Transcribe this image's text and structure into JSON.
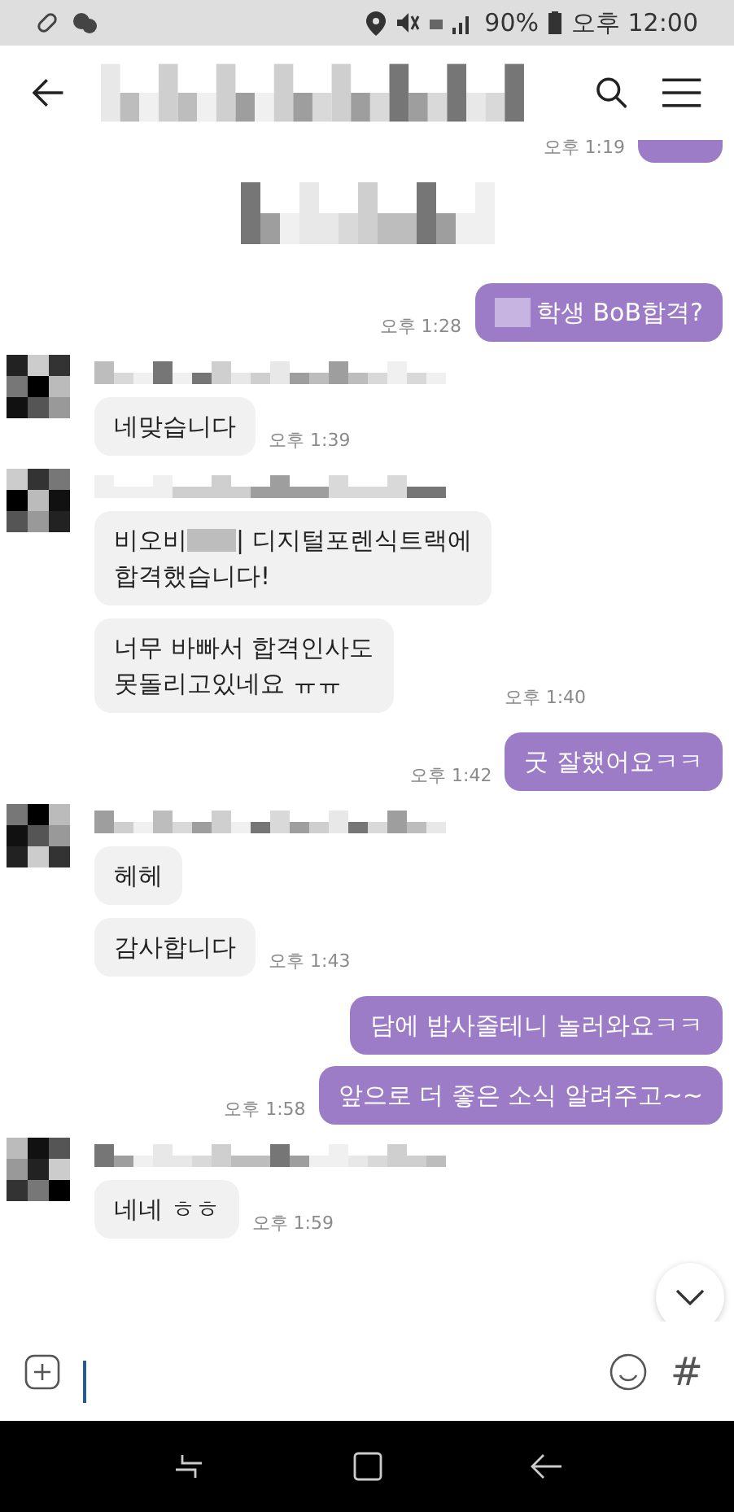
{
  "status_bar": {
    "battery_text": "90%",
    "time": "오후 12:00"
  },
  "chat": [
    {
      "kind": "sent_cut_off",
      "time": "오후 1:19"
    },
    {
      "kind": "notice"
    },
    {
      "kind": "sent",
      "messages": [
        {
          "redact_before": true,
          "text": "학생 BoB합격?"
        }
      ],
      "time": "오후 1:28"
    },
    {
      "kind": "received",
      "messages": [
        {
          "text": "네맞습니다"
        }
      ],
      "time": "오후 1:39"
    },
    {
      "kind": "received",
      "messages": [
        {
          "text_before": "비오비",
          "text": "| 디지털포렌식트랙에\n합격했습니다!"
        },
        {
          "text": "너무 바빠서 합격인사도\n못돌리고있네요 ㅠㅠ"
        }
      ],
      "time": "오후 1:40"
    },
    {
      "kind": "sent",
      "messages": [
        {
          "text": "굿  잘했어요ㅋㅋ"
        }
      ],
      "time": "오후 1:42"
    },
    {
      "kind": "received",
      "messages": [
        {
          "text": "헤헤"
        },
        {
          "text": "감사합니다"
        }
      ],
      "time": "오후 1:43"
    },
    {
      "kind": "sent",
      "messages": [
        {
          "text": "담에 밥사줄테니 놀러와요ㅋㅋ"
        },
        {
          "text": "앞으로 더  좋은 소식  알려주고~~"
        }
      ],
      "time": "오후 1:58"
    },
    {
      "kind": "received",
      "messages": [
        {
          "text": "네네 ㅎㅎ"
        }
      ],
      "time": "오후 1:59"
    }
  ],
  "input_bar": {
    "hash_button": "#"
  }
}
